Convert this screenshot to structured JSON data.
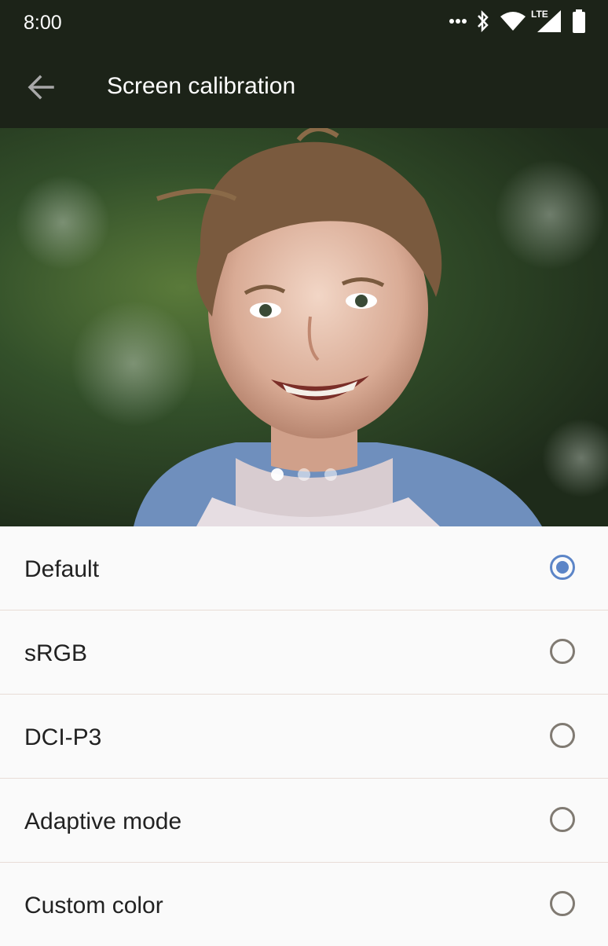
{
  "status_bar": {
    "time": "8:00",
    "network_label": "LTE",
    "icons": [
      "more-dots-icon",
      "bluetooth-icon",
      "wifi-icon",
      "signal-icon",
      "battery-icon"
    ]
  },
  "app_bar": {
    "title": "Screen calibration",
    "back_icon": "arrow-back-icon"
  },
  "preview": {
    "page_count": 3,
    "active_page": 1
  },
  "options": [
    {
      "label": "Default",
      "selected": true
    },
    {
      "label": "sRGB",
      "selected": false
    },
    {
      "label": "DCI-P3",
      "selected": false
    },
    {
      "label": "Adaptive mode",
      "selected": false
    },
    {
      "label": "Custom color",
      "selected": false
    }
  ],
  "colors": {
    "app_bar_bg": "#1c2318",
    "radio_accent": "#5c85c7",
    "radio_unselected": "#807a72",
    "list_bg": "#fafafa",
    "divider": "#e8dcd6"
  }
}
